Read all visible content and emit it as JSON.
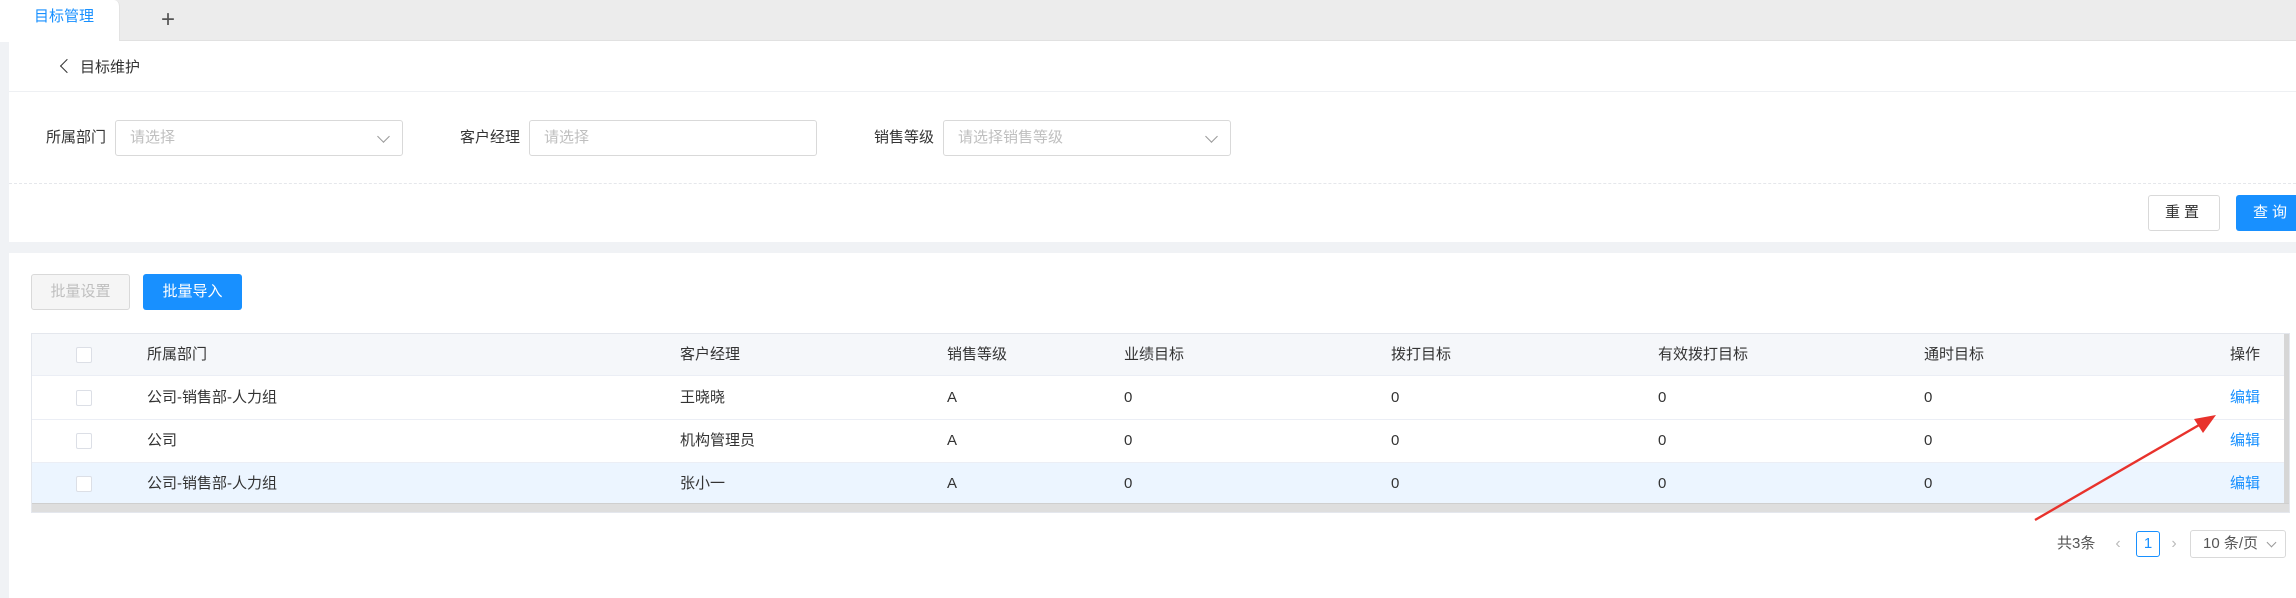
{
  "tabs": {
    "active_label": "目标管理",
    "add_label": "+"
  },
  "header": {
    "back_label": "目标维护"
  },
  "filters": {
    "dept_label": "所属部门",
    "dept_placeholder": "请选择",
    "manager_label": "客户经理",
    "manager_placeholder": "请选择",
    "level_label": "销售等级",
    "level_placeholder": "请选择销售等级",
    "reset_label": "重置",
    "query_label": "查询"
  },
  "toolbar": {
    "batch_set_label": "批量设置",
    "batch_import_label": "批量导入"
  },
  "table": {
    "columns": [
      "所属部门",
      "客户经理",
      "销售等级",
      "业绩目标",
      "拨打目标",
      "有效拨打目标",
      "通时目标",
      "操作"
    ],
    "rows": [
      {
        "dept": "公司-销售部-人力组",
        "manager": "王晓晓",
        "level": "A",
        "perf": "0",
        "dial": "0",
        "valid_dial": "0",
        "talk": "0",
        "action": "编辑"
      },
      {
        "dept": "公司",
        "manager": "机构管理员",
        "level": "A",
        "perf": "0",
        "dial": "0",
        "valid_dial": "0",
        "talk": "0",
        "action": "编辑"
      },
      {
        "dept": "公司-销售部-人力组",
        "manager": "张小一",
        "level": "A",
        "perf": "0",
        "dial": "0",
        "valid_dial": "0",
        "talk": "0",
        "action": "编辑"
      }
    ]
  },
  "pagination": {
    "total_label": "共3条",
    "current_page": "1",
    "page_size_label": "10 条/页"
  },
  "colors": {
    "primary": "#1890ff",
    "annotation_arrow": "#e8322c",
    "highlight_row": "#ecf5ff"
  }
}
